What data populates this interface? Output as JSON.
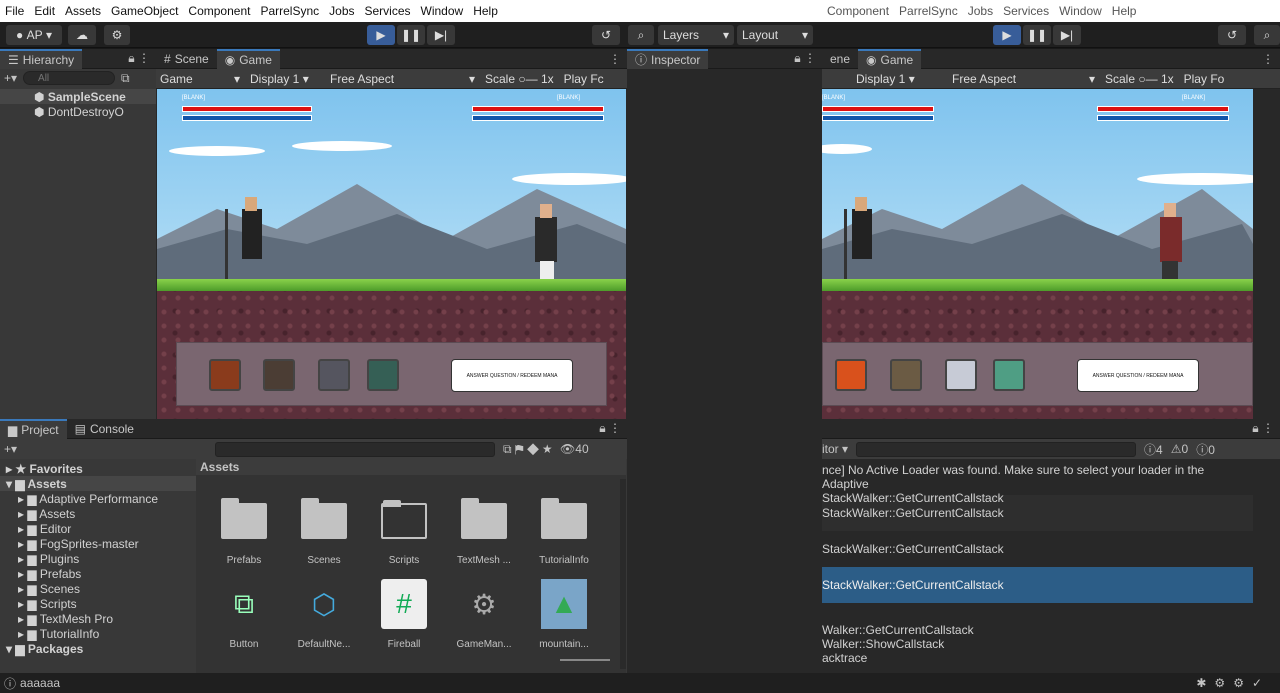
{
  "menu_left": [
    "File",
    "Edit",
    "Assets",
    "GameObject",
    "Component",
    "ParrelSync",
    "Jobs",
    "Services",
    "Window",
    "Help"
  ],
  "menu_right": [
    "Component",
    "ParrelSync",
    "Jobs",
    "Services",
    "Window",
    "Help"
  ],
  "toolbar": {
    "account": "AP",
    "layers": "Layers",
    "layout": "Layout"
  },
  "hierarchy": {
    "tab": "Hierarchy",
    "search_placeholder": "All",
    "items": [
      "SampleScene",
      "DontDestroyO"
    ]
  },
  "game_left": {
    "tab_scene": "Scene",
    "tab_game": "Game",
    "mode": "Game",
    "display": "Display 1",
    "aspect": "Free Aspect",
    "scale_label": "Scale",
    "scale_value": "1x",
    "play_focus": "Play Fc"
  },
  "game_right": {
    "tab_scene": "ene",
    "tab_game": "Game",
    "display": "Display 1",
    "aspect": "Free Aspect",
    "scale_label": "Scale",
    "scale_value": "1x",
    "play_focus": "Play Fo"
  },
  "hud": {
    "left_name": "[BLANK]",
    "right_name": "[BLANK]",
    "answer_button": "ANSWER QUESTION / REDEEM MANA"
  },
  "inspector": {
    "tab": "Inspector"
  },
  "project": {
    "tab_project": "Project",
    "tab_console": "Console",
    "count": "40",
    "breadcrumb": "Assets",
    "tree": [
      "Favorites",
      "Assets",
      "Adaptive Performance",
      "Assets",
      "Editor",
      "FogSprites-master",
      "Plugins",
      "Prefabs",
      "Scenes",
      "Scripts",
      "TextMesh Pro",
      "TutorialInfo",
      "Packages"
    ],
    "assets_row1": [
      "Prefabs",
      "Scenes",
      "Scripts",
      "TextMesh ...",
      "TutorialInfo"
    ],
    "assets_row2": [
      "Button",
      "DefaultNe...",
      "Fireball",
      "GameMan...",
      "mountain..."
    ]
  },
  "console": {
    "dropdown": "itor",
    "warn_count": "4",
    "alert_count": "0",
    "error_count": "0",
    "rows": [
      "nce] No Active Loader was found. Make sure to select your loader in the Adaptive",
      "StackWalker::GetCurrentCallstack",
      "StackWalker::GetCurrentCallstack",
      "StackWalker::GetCurrentCallstack",
      "StackWalker::GetCurrentCallstack"
    ],
    "detail": [
      "Walker::GetCurrentCallstack",
      "Walker::ShowCallstack",
      "acktrace"
    ]
  },
  "status": {
    "text": "aaaaaa"
  },
  "colors": {
    "accent": "#3a79bb",
    "selection": "#2c5d87",
    "play": "#385d99"
  }
}
